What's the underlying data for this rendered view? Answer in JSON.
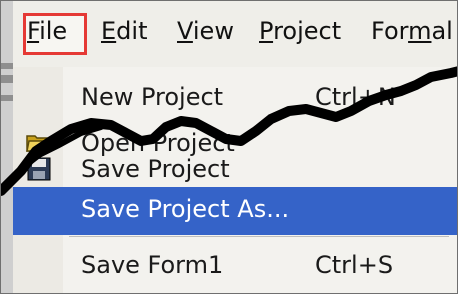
{
  "menubar": {
    "items": [
      {
        "label": "File",
        "mnemonic": "F"
      },
      {
        "label": "Edit",
        "mnemonic": "E"
      },
      {
        "label": "View",
        "mnemonic": "V"
      },
      {
        "label": "Project",
        "mnemonic": "P"
      },
      {
        "label": "Formal",
        "mnemonic": "m"
      }
    ],
    "highlight_color": "#e53935"
  },
  "file_menu": {
    "items": [
      {
        "label": "New Project",
        "shortcut": "Ctrl+N"
      },
      {
        "label": "Open Project",
        "shortcut": ""
      },
      {
        "label": "Save Project",
        "shortcut": ""
      },
      {
        "label": "Save Project As...",
        "shortcut": "",
        "selected": true
      },
      {
        "label": "Save Form1",
        "shortcut": "Ctrl+S"
      }
    ],
    "selected_color": "#3563c8"
  },
  "icons": {
    "open": "folder-open-icon",
    "save": "floppy-disk-icon"
  }
}
